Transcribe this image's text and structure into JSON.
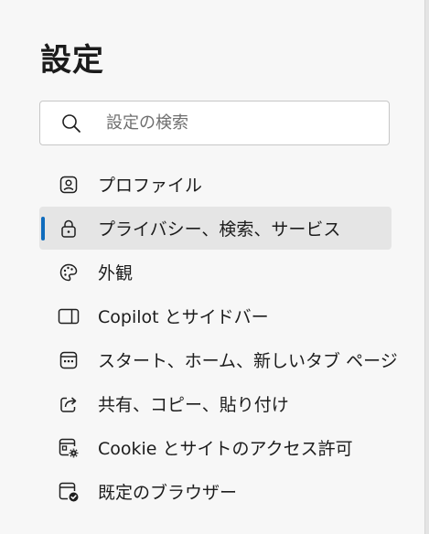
{
  "page": {
    "title": "設定"
  },
  "search": {
    "icon": "search-icon",
    "placeholder": "設定の検索",
    "value": ""
  },
  "nav": {
    "items": [
      {
        "label": "プロファイル",
        "icon": "profile-icon",
        "selected": false
      },
      {
        "label": "プライバシー、検索、サービス",
        "icon": "lock-icon",
        "selected": true
      },
      {
        "label": "外観",
        "icon": "palette-icon",
        "selected": false
      },
      {
        "label": "Copilot とサイドバー",
        "icon": "sidebar-icon",
        "selected": false
      },
      {
        "label": "スタート、ホーム、新しいタブ ページ",
        "icon": "new-tab-page-icon",
        "selected": false
      },
      {
        "label": "共有、コピー、貼り付け",
        "icon": "share-icon",
        "selected": false
      },
      {
        "label": "Cookie とサイトのアクセス許可",
        "icon": "site-permissions-icon",
        "selected": false
      },
      {
        "label": "既定のブラウザー",
        "icon": "default-browser-icon",
        "selected": false
      }
    ]
  },
  "colors": {
    "accent": "#0f6cbd",
    "background": "#f7f7f7",
    "selected_background": "#e5e5e5",
    "text": "#1a1a1a"
  }
}
